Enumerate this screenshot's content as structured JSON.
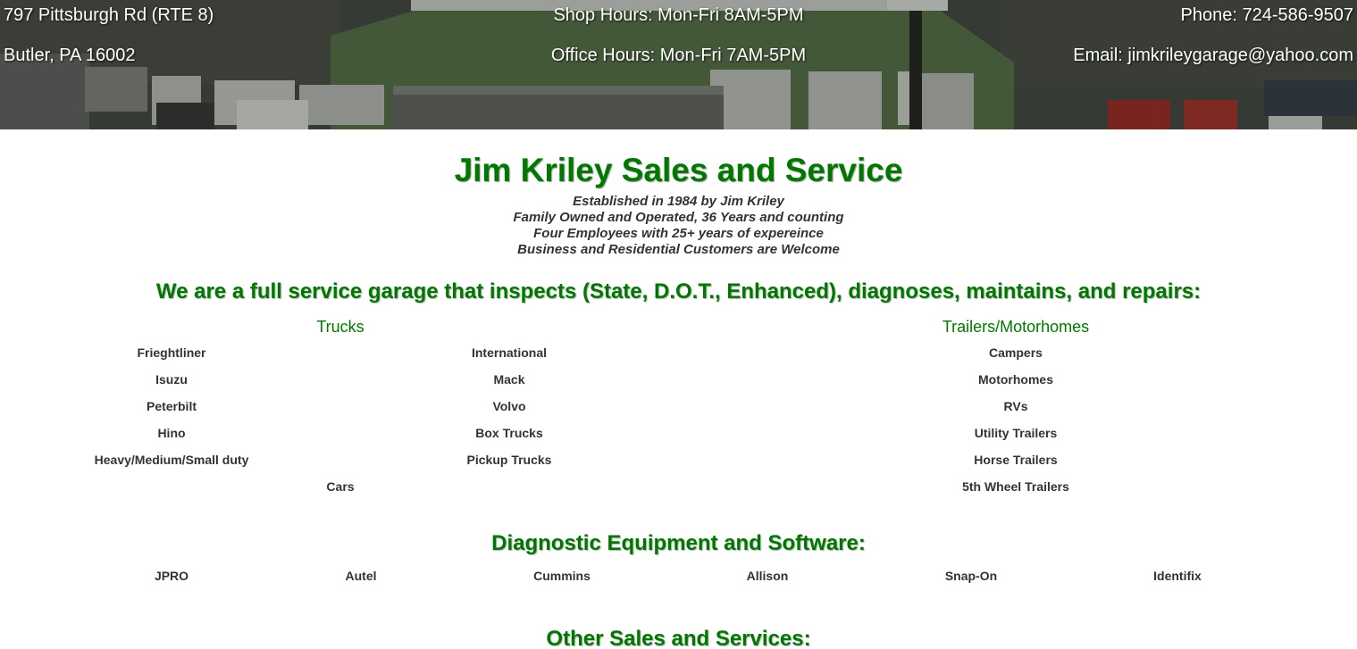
{
  "header": {
    "address_line1": "797 Pittsburgh Rd (RTE 8)",
    "address_line2": "Butler, PA 16002",
    "shop_hours": "Shop Hours: Mon-Fri 8AM-5PM",
    "office_hours": "Office Hours: Mon-Fri 7AM-5PM",
    "phone": "Phone: 724-586-9507",
    "email": "Email: jimkrileygarage@yahoo.com"
  },
  "title": "Jim Kriley Sales and Service",
  "tagline": [
    "Established in 1984 by Jim Kriley",
    "Family Owned and Operated, 36 Years and counting",
    "Four Employees with 25+ years of expereince",
    "Business and Residential Customers are Welcome"
  ],
  "services_heading": "We are a full service garage that inspects (State, D.O.T., Enhanced), diagnoses, maintains, and repairs:",
  "trucks": {
    "title": "Trucks",
    "col1": [
      "Frieghtliner",
      "Isuzu",
      "Peterbilt",
      "Hino",
      "Heavy/Medium/Small duty"
    ],
    "col2": [
      "International",
      "Mack",
      "Volvo",
      "Box Trucks",
      "Pickup Trucks"
    ],
    "extra": "Cars"
  },
  "trailers": {
    "title": "Trailers/Motorhomes",
    "items": [
      "Campers",
      "Motorhomes",
      "RVs",
      "Utility Trailers",
      "Horse Trailers",
      "5th Wheel Trailers"
    ]
  },
  "diagnostic_heading": "Diagnostic Equipment and Software:",
  "diagnostic_items": [
    "JPRO",
    "Autel",
    "Cummins",
    "Allison",
    "Snap-On",
    "Identifix"
  ],
  "other_heading": "Other Sales and Services:",
  "colors": {
    "brand_green": "#007800",
    "body_text": "#333333",
    "header_text": "#ffffff"
  }
}
